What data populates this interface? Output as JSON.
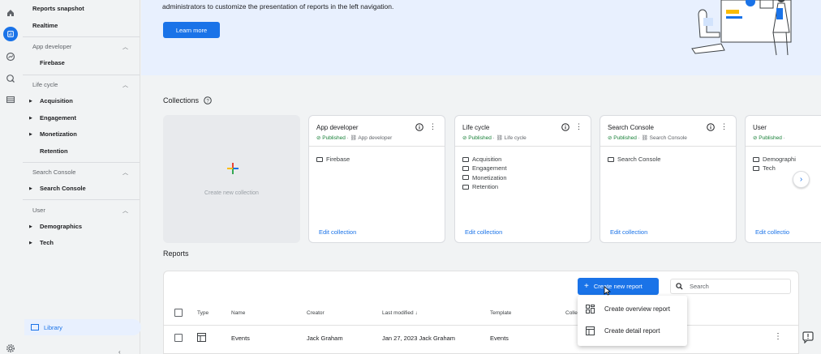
{
  "nav": {
    "reports_snapshot": "Reports snapshot",
    "realtime": "Realtime",
    "sections": [
      {
        "title": "App developer",
        "items": [
          "Firebase"
        ]
      },
      {
        "title": "Life cycle",
        "items": [
          "Acquisition",
          "Engagement",
          "Monetization",
          "Retention"
        ]
      },
      {
        "title": "Search Console",
        "items": [
          "Search Console"
        ]
      },
      {
        "title": "User",
        "items": [
          "Demographics",
          "Tech"
        ]
      }
    ],
    "library": "Library"
  },
  "banner": {
    "text": "administrators to customize the presentation of reports in the left navigation.",
    "button": "Learn more"
  },
  "collections": {
    "title": "Collections",
    "new_label": "Create new collection",
    "cards": [
      {
        "title": "App developer",
        "status": "Published",
        "platform": "App developer",
        "folders": [
          "Firebase"
        ],
        "edit": "Edit collection"
      },
      {
        "title": "Life cycle",
        "status": "Published",
        "platform": "Life cycle",
        "folders": [
          "Acquisition",
          "Engagement",
          "Monetization",
          "Retention"
        ],
        "edit": "Edit collection"
      },
      {
        "title": "Search Console",
        "status": "Published",
        "platform": "Search Console",
        "folders": [
          "Search Console"
        ],
        "edit": "Edit collection"
      },
      {
        "title": "User",
        "status": "Published",
        "platform": "",
        "folders": [
          "Demographi",
          "Tech"
        ],
        "edit": "Edit collectio"
      }
    ]
  },
  "reports": {
    "title": "Reports",
    "create_button": "Create new report",
    "search_placeholder": "Search",
    "columns": [
      "Type",
      "Name",
      "Creator",
      "Last modified",
      "Template",
      "Colle"
    ],
    "rows": [
      {
        "name": "Events",
        "creator": "Jack Graham",
        "modified": "Jan 27, 2023 Jack Graham",
        "template": "Events"
      }
    ]
  },
  "menu": {
    "items": [
      "Create overview report",
      "Create detail report"
    ]
  },
  "colors": {
    "accent": "#1a73e8",
    "published": "#188038",
    "banner_bg": "#e8f0fe"
  }
}
